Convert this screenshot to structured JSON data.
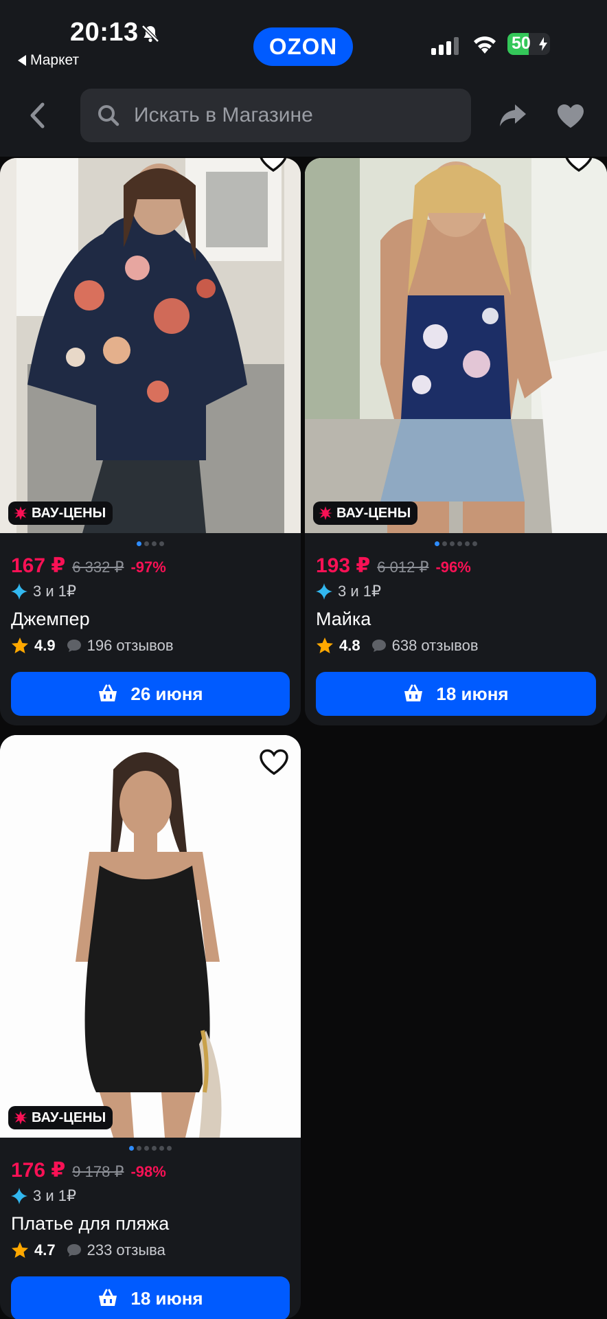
{
  "status": {
    "time": "20:13",
    "back_app": "Маркет",
    "battery": "50",
    "battery_level": 0.5
  },
  "header": {
    "logo": "OZON",
    "search_placeholder": "Искать в Магазине"
  },
  "products": [
    {
      "badge": "ВАУ-ЦЕНЫ",
      "price": "167 ₽",
      "old_price": "6 332 ₽",
      "discount": "-97%",
      "installment": "3 и 1₽",
      "title": "Джемпер",
      "rating": "4.9",
      "reviews": "196 отзывов",
      "delivery": "26 июня",
      "dots": 4,
      "active_dot": 0
    },
    {
      "badge": "ВАУ-ЦЕНЫ",
      "price": "193 ₽",
      "old_price": "6 012 ₽",
      "discount": "-96%",
      "installment": "3 и 1₽",
      "title": "Майка",
      "rating": "4.8",
      "reviews": "638 отзывов",
      "delivery": "18 июня",
      "dots": 6,
      "active_dot": 0
    },
    {
      "badge": "ВАУ-ЦЕНЫ",
      "price": "176 ₽",
      "old_price": "9 178 ₽",
      "discount": "-98%",
      "installment": "3 и 1₽",
      "title": "Платье для пляжа",
      "rating": "4.7",
      "reviews": "233 отзыва",
      "delivery": "18 июня",
      "dots": 6,
      "active_dot": 0
    }
  ],
  "colors": {
    "accent": "#005bff",
    "price": "#f91155",
    "rating_star": "#ffa800"
  }
}
